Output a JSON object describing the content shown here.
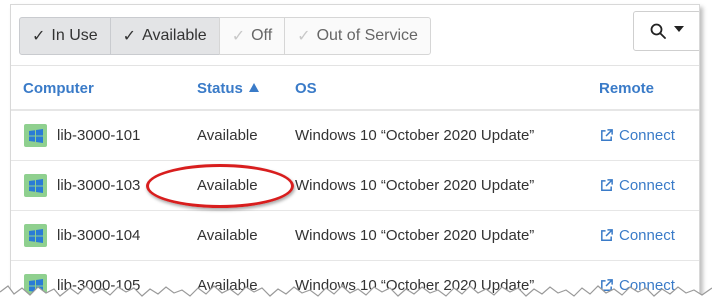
{
  "filters": [
    {
      "label": "In Use",
      "checked": true
    },
    {
      "label": "Available",
      "checked": true
    },
    {
      "label": "Off",
      "checked": false
    },
    {
      "label": "Out of Service",
      "checked": false
    }
  ],
  "check_glyph": "✓",
  "search": {
    "icon": "search-icon",
    "menu_icon": "caret-down-icon"
  },
  "columns": {
    "computer": "Computer",
    "status": "Status",
    "os": "OS",
    "remote": "Remote"
  },
  "sort": {
    "column": "status",
    "direction": "ascending"
  },
  "rows": [
    {
      "name": "lib-3000-101",
      "status": "Available",
      "os": "Windows 10 “October 2020 Update”",
      "remote": "Connect"
    },
    {
      "name": "lib-3000-103",
      "status": "Available",
      "os": "Windows 10 “October 2020 Update”",
      "remote": "Connect"
    },
    {
      "name": "lib-3000-104",
      "status": "Available",
      "os": "Windows 10 “October 2020 Update”",
      "remote": "Connect"
    },
    {
      "name": "lib-3000-105",
      "status": "Available",
      "os": "Windows 10 “October 2020 Update”",
      "remote": "Connect"
    }
  ],
  "colors": {
    "link": "#3a7bc8",
    "highlight": "#d81e1e",
    "windows_tile": "#8fd08f"
  }
}
